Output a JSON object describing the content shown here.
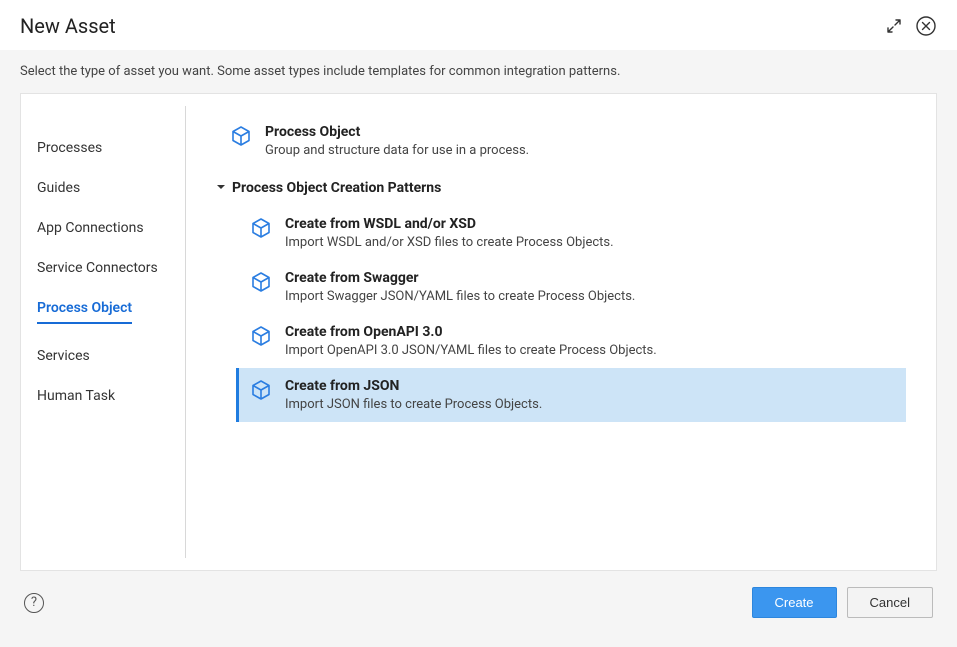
{
  "dialog": {
    "title": "New Asset",
    "subtitle": "Select the type of asset you want. Some asset types include templates for common integration patterns."
  },
  "sidebar": {
    "items": [
      {
        "label": "Processes",
        "active": false
      },
      {
        "label": "Guides",
        "active": false
      },
      {
        "label": "App Connections",
        "active": false
      },
      {
        "label": "Service Connectors",
        "active": false
      },
      {
        "label": "Process Object",
        "active": true
      },
      {
        "label": "Services",
        "active": false
      },
      {
        "label": "Human Task",
        "active": false
      }
    ]
  },
  "content": {
    "primary": {
      "title": "Process Object",
      "desc": "Group and structure data for use in a process."
    },
    "section_label": "Process Object Creation Patterns",
    "patterns": [
      {
        "title": "Create from WSDL and/or XSD",
        "desc": "Import WSDL and/or XSD files to create Process Objects.",
        "selected": false
      },
      {
        "title": "Create from Swagger",
        "desc": "Import Swagger JSON/YAML files to create Process Objects.",
        "selected": false
      },
      {
        "title": "Create from OpenAPI 3.0",
        "desc": "Import OpenAPI 3.0 JSON/YAML files to create Process Objects.",
        "selected": false
      },
      {
        "title": "Create from JSON",
        "desc": "Import JSON files to create Process Objects.",
        "selected": true
      }
    ]
  },
  "footer": {
    "create": "Create",
    "cancel": "Cancel"
  },
  "colors": {
    "accent": "#176bd6",
    "selection_bg": "#cde4f7",
    "selection_border": "#1f7ce0",
    "primary_btn": "#3b96ef"
  }
}
